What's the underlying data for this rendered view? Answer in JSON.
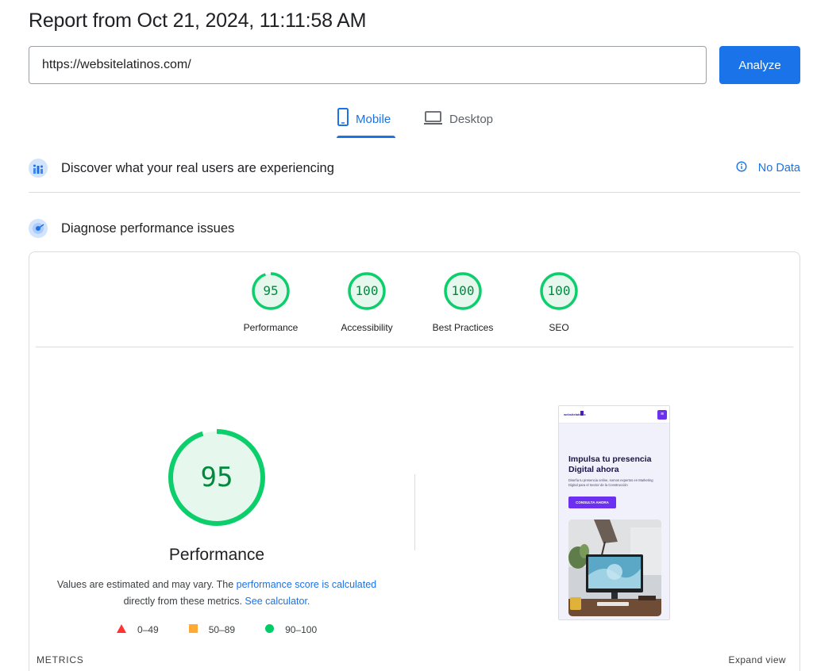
{
  "report": {
    "title": "Report from Oct 21, 2024, 11:11:58 AM"
  },
  "search": {
    "url_value": "https://websitelatinos.com/",
    "analyze_label": "Analyze"
  },
  "tabs": {
    "mobile_label": "Mobile",
    "desktop_label": "Desktop",
    "selected": "Mobile"
  },
  "crux": {
    "title": "Discover what your real users are experiencing",
    "status_label": "No Data"
  },
  "diagnose": {
    "title": "Diagnose performance issues"
  },
  "scores": [
    {
      "label": "Performance",
      "value": "95"
    },
    {
      "label": "Accessibility",
      "value": "100"
    },
    {
      "label": "Best Practices",
      "value": "100"
    },
    {
      "label": "SEO",
      "value": "100"
    }
  ],
  "performance": {
    "score": "95",
    "label": "Performance",
    "desc_prefix": "Values are estimated and may vary. The ",
    "desc_link1": "performance score is calculated",
    "desc_mid": " directly from these metrics. ",
    "desc_link2": "See calculator.",
    "legend": [
      {
        "range": "0–49",
        "shape": "triangle",
        "color": "#ff3333"
      },
      {
        "range": "50–89",
        "shape": "square",
        "color": "#ffaa33"
      },
      {
        "range": "90–100",
        "shape": "circle",
        "color": "#00cc66"
      }
    ]
  },
  "preview": {
    "hero_title": "Impulsa tu presencia Digital ahora",
    "hero_subtitle": "Diseña tu presencia online, somos expertos en Marketing Digital para el Sector de la Construcción",
    "cta_label": "CONSULTA AHORA",
    "logo_text": "websitelatinos"
  },
  "metrics": {
    "section_label": "METRICS",
    "expand_label": "Expand view"
  },
  "colors": {
    "accent": "#1a73e8",
    "pass_green": "#0cce6b",
    "pass_text": "#008a3e",
    "pass_fill": "#e6f7ee"
  }
}
